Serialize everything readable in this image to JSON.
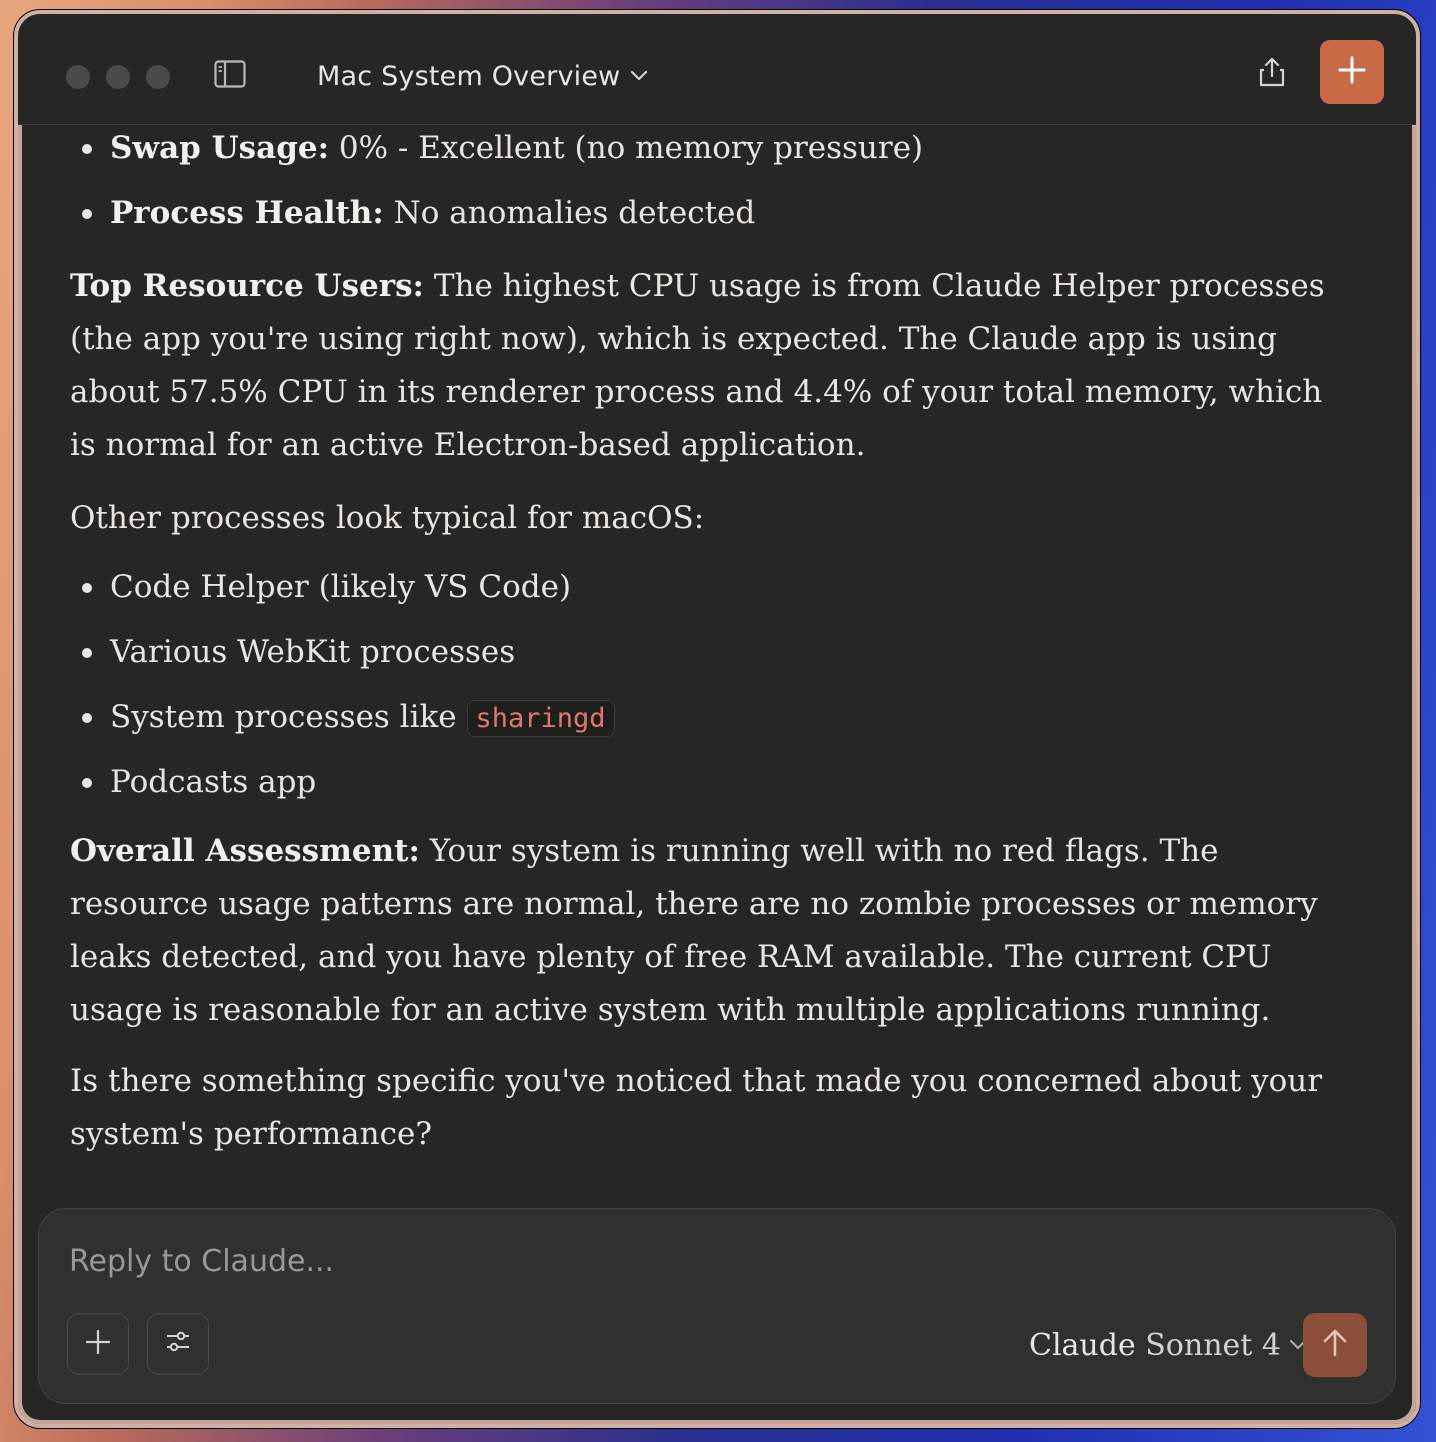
{
  "window": {
    "title": "Mac System Overview"
  },
  "message": {
    "top_bullets": [
      {
        "label": "Swap Usage:",
        "text": " 0% - Excellent (no memory pressure)"
      },
      {
        "label": "Process Health:",
        "text": " No anomalies detected"
      }
    ],
    "top_users": {
      "label": "Top Resource Users:",
      "text": " The highest CPU usage is from Claude Helper processes (the app you're using right now), which is expected. The Claude app is using about 57.5% CPU in its renderer process and 4.4% of your total memory, which is normal for an active Electron-based application."
    },
    "other_intro": "Other processes look typical for macOS:",
    "other_items": [
      "Code Helper (likely VS Code)",
      "Various WebKit processes",
      "System processes like ",
      "Podcasts app"
    ],
    "code_snippet": "sharingd",
    "assessment": {
      "label": "Overall Assessment:",
      "text": " Your system is running well with no red flags. The resource usage patterns are normal, there are no zombie processes or memory leaks detected, and you have plenty of free RAM available. The current CPU usage is reasonable for an active system with multiple applications running."
    },
    "closing": "Is there something specific you've noticed that made you concerned about your system's performance?"
  },
  "composer": {
    "placeholder": "Reply to Claude...",
    "model_brand": "Claude",
    "model_version": " Sonnet 4"
  },
  "icons": {
    "sidebar": "sidebar-toggle-icon",
    "chevron": "chevron-down-icon",
    "share": "share-icon",
    "new_chat": "plus-icon",
    "attach": "plus-icon",
    "tools": "sliders-icon",
    "send": "arrow-up-icon"
  },
  "colors": {
    "accent": "#c96a47",
    "send_disabled": "#8a4e3a",
    "code_text": "#e0796b",
    "background": "#262624"
  }
}
